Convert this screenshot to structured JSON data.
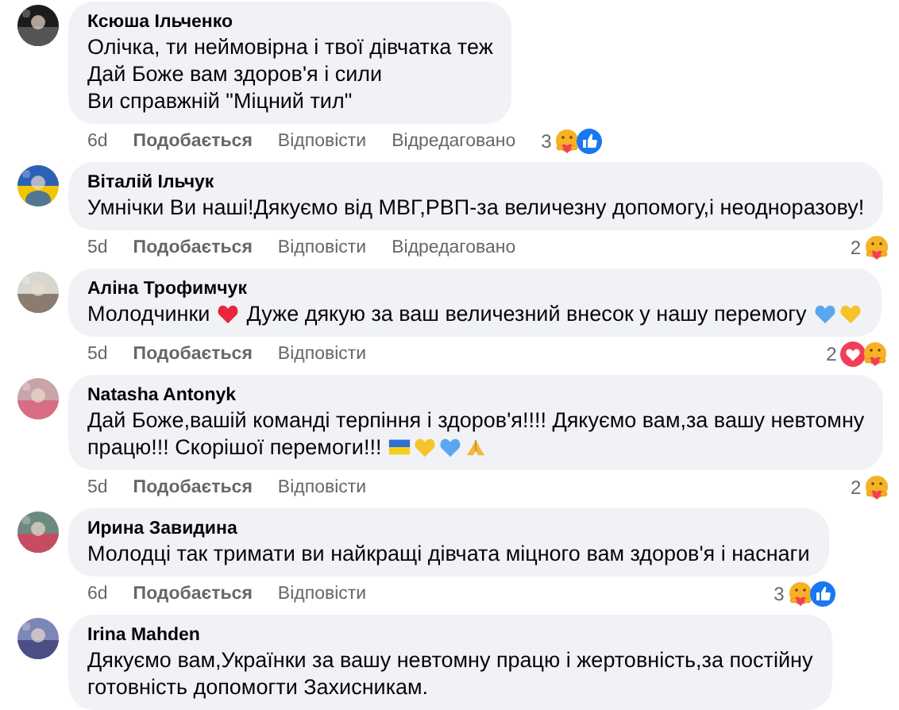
{
  "comments": [
    {
      "author": "Ксюша Ільченко",
      "lines": [
        {
          "text": "Олічка, ти неймовірна і твої дівчатка теж"
        },
        {
          "text": "Дай Боже вам здоров'я і сили"
        },
        {
          "text": "Ви справжній \"Міцний тил\""
        }
      ],
      "time": "6d",
      "like": "Подобається",
      "reply": "Відповісти",
      "edited": "Відредаговано",
      "reaction_count": "3",
      "reactions": [
        {
          "kind": "care"
        },
        {
          "kind": "like"
        }
      ]
    },
    {
      "author": "Віталій Ільчук",
      "lines": [
        {
          "text": "Умнічки Ви наші!Дякуємо від МВГ,РВП-за величезну допомогу,і неодноразову!"
        }
      ],
      "time": "5d",
      "like": "Подобається",
      "reply": "Відповісти",
      "edited": "Відредаговано",
      "reaction_count": "2",
      "reactions": [
        {
          "kind": "care"
        }
      ]
    },
    {
      "author": "Аліна Трофимчук",
      "lines": [
        {
          "text": "Молодчинки",
          "emojis_after_first_word": [
            {
              "kind": "heart",
              "color": "#e8263d"
            }
          ],
          "rest": "Дуже дякую за ваш величезний внесок у нашу перемогу",
          "emojis": [
            {
              "kind": "heart",
              "color": "#5aa7f0"
            },
            {
              "kind": "heart",
              "color": "#f5c32c"
            }
          ]
        }
      ],
      "time": "5d",
      "like": "Подобається",
      "reply": "Відповісти",
      "reaction_count": "2",
      "reactions": [
        {
          "kind": "love"
        },
        {
          "kind": "care"
        }
      ]
    },
    {
      "author": "Natasha Antonyk",
      "lines": [
        {
          "text": "Дай Боже,вашій команді терпіння і здоров'я!!!! Дякуємо вам,за вашу невтомну"
        },
        {
          "text": "працю!!! Скорішої перемоги!!!",
          "emojis": [
            {
              "kind": "flag"
            },
            {
              "kind": "heart",
              "color": "#f5c32c"
            },
            {
              "kind": "heart",
              "color": "#5aa7f0"
            },
            {
              "kind": "hands"
            }
          ]
        }
      ],
      "time": "5d",
      "like": "Подобається",
      "reply": "Відповісти",
      "reaction_count": "2",
      "reactions": [
        {
          "kind": "care"
        }
      ]
    },
    {
      "author": "Ирина Завидина",
      "lines": [
        {
          "text": "Молодці так тримати ви найкращі дівчата міцного вам здоров'я і наснаги"
        }
      ],
      "time": "6d",
      "like": "Подобається",
      "reply": "Відповісти",
      "reaction_count": "3",
      "reactions": [
        {
          "kind": "care"
        },
        {
          "kind": "like"
        }
      ]
    },
    {
      "author": "Irina Mahden",
      "lines": [
        {
          "text": "Дякуємо вам,Українки за вашу невтомну працю і жертовність,за постійну"
        },
        {
          "text": "готовність допомогти Захисникам."
        }
      ]
    }
  ]
}
